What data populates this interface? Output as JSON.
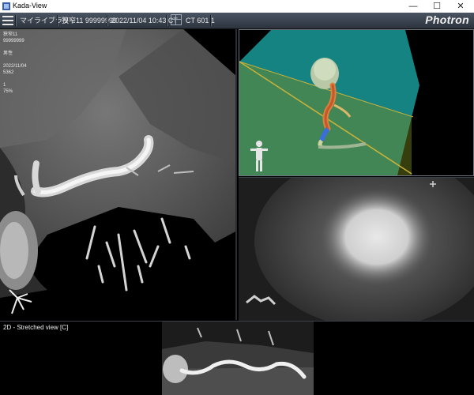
{
  "window": {
    "title": "Kada-View",
    "minimize": "—",
    "maximize": "☐",
    "close": "✕"
  },
  "toolbar": {
    "library_label": "マイライブラリ",
    "patient": "狭窄11 99999999",
    "study_datetime": "2022/11/04 10:43 CT",
    "series": "CT 601 1",
    "brand": "Photron"
  },
  "main_view": {
    "overlay_lines": [
      "狭窄11",
      "99999999",
      "",
      "男性",
      "",
      "2022/11/04",
      "5362",
      "",
      "1",
      "75%"
    ]
  },
  "stretch_view": {
    "label": "2D - Stretched view [C]"
  },
  "colors": {
    "toolbar": "#3a424d",
    "plane_teal": "#1fa3a3",
    "plane_yellow": "#9a8a18",
    "vessel_orange": "#d9823a"
  },
  "icons": [
    "app-icon",
    "menu-icon",
    "series-icon",
    "crosshair-icon",
    "patient-figure-icon",
    "orientation-icon"
  ]
}
